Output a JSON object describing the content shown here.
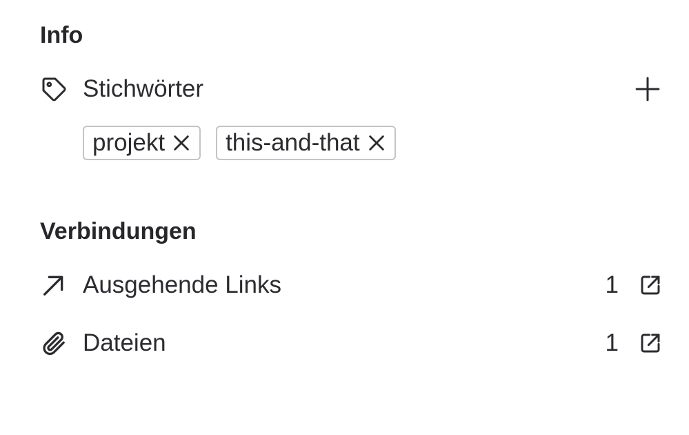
{
  "info": {
    "title": "Info",
    "keywords": {
      "label": "Stichwörter",
      "icon": "tag-icon",
      "add_icon": "plus-icon",
      "tags": [
        {
          "label": "projekt",
          "remove_icon": "close-icon"
        },
        {
          "label": "this-and-that",
          "remove_icon": "close-icon"
        }
      ]
    }
  },
  "connections": {
    "title": "Verbindungen",
    "items": [
      {
        "label": "Ausgehende Links",
        "count": "1",
        "icon": "arrow-up-right-icon",
        "open_icon": "external-link-icon"
      },
      {
        "label": "Dateien",
        "count": "1",
        "icon": "paperclip-icon",
        "open_icon": "external-link-icon"
      }
    ]
  },
  "colors": {
    "text": "#2b2b30",
    "tag_border": "#c4c4c8",
    "background": "#ffffff"
  }
}
